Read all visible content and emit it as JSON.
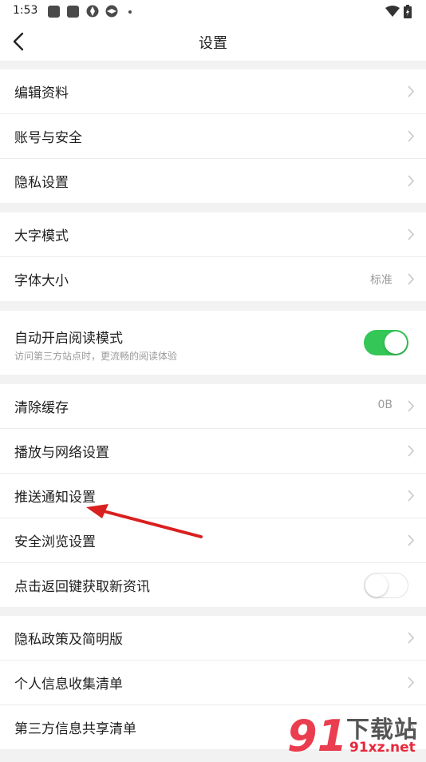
{
  "status_bar": {
    "time": "1:53"
  },
  "header": {
    "title": "设置"
  },
  "groups": [
    {
      "items": [
        {
          "label": "编辑资料"
        },
        {
          "label": "账号与安全"
        },
        {
          "label": "隐私设置"
        }
      ]
    },
    {
      "items": [
        {
          "label": "大字模式"
        },
        {
          "label": "字体大小",
          "value": "标准"
        }
      ]
    },
    {
      "items": [
        {
          "label": "自动开启阅读模式",
          "description": "访问第三方站点时，更流畅的阅读体验",
          "toggle": "on"
        }
      ]
    },
    {
      "items": [
        {
          "label": "清除缓存",
          "value": "0B"
        },
        {
          "label": "播放与网络设置"
        },
        {
          "label": "推送通知设置"
        },
        {
          "label": "安全浏览设置"
        },
        {
          "label": "点击返回键获取新资讯",
          "toggle": "off"
        }
      ]
    },
    {
      "items": [
        {
          "label": "隐私政策及简明版"
        },
        {
          "label": "个人信息收集清单"
        },
        {
          "label": "第三方信息共享清单"
        }
      ]
    }
  ],
  "watermark": {
    "text": "下载站",
    "url_text": "91xz.net"
  },
  "colors": {
    "toggle_on": "#34c758",
    "annotation_arrow": "#d9201f"
  }
}
